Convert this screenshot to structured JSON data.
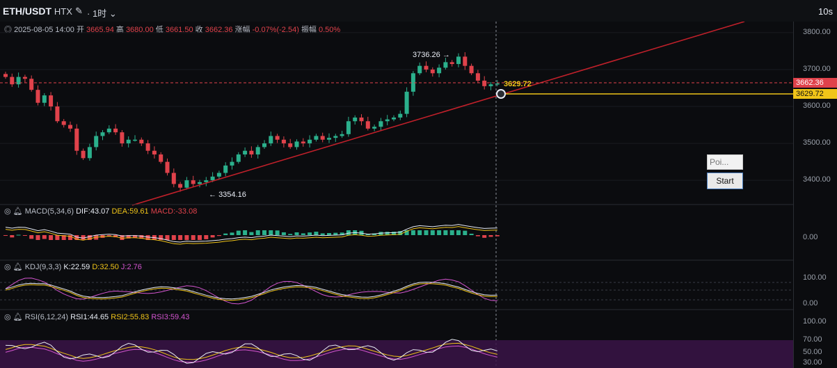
{
  "header": {
    "symbol": "ETH/USDT",
    "exchange": "HTX",
    "timeframe": "1时",
    "refresh": "10s",
    "icons": [
      "edit-icon",
      "chevron-down-icon"
    ]
  },
  "ohlc": {
    "datetime": "2025-08-05 14:00",
    "open_label": "开",
    "open": "3665.94",
    "high_label": "高",
    "high": "3680.00",
    "low_label": "低",
    "low": "3661.50",
    "close_label": "收",
    "close": "3662.36",
    "change_label": "涨幅",
    "change": "-0.07%(-2.54)",
    "amp_label": "振幅",
    "amp": "0.50%"
  },
  "price_axis": [
    "3800.00",
    "3700.00",
    "3600.00",
    "3500.00",
    "3400.00"
  ],
  "price_tags": {
    "last": "3662.36",
    "cursor": "3629.72"
  },
  "annotations": {
    "high": "3736.26",
    "low": "3354.16",
    "cursor": "3629.72"
  },
  "macd": {
    "name": "MACD(5,34,6)",
    "dif": "DIF:43.07",
    "dea": "DEA:59.61",
    "macd": "MACD:-33.08",
    "axis": [
      "0.00"
    ]
  },
  "kdj": {
    "name": "KDJ(9,3,3)",
    "k": "K:22.59",
    "d": "D:32.50",
    "j": "J:2.76",
    "axis": [
      "100.00",
      "0.00"
    ]
  },
  "rsi": {
    "name": "RSI(6,12,24)",
    "rsi1": "RSI1:44.65",
    "rsi2": "RSI2:55.83",
    "rsi3": "RSI3:59.43",
    "axis": [
      "100.00",
      "70.00",
      "50.00",
      "30.00"
    ]
  },
  "widget": {
    "input_placeholder": "Poi...",
    "start_label": "Start"
  },
  "colors": {
    "up": "#2bb08c",
    "down": "#e0424b",
    "trendline": "#c0202a",
    "cursor": "#f0c419",
    "rsi_band": "#3a1446"
  },
  "chart_data": {
    "type": "candlestick",
    "closes": [
      3680,
      3660,
      3680,
      3675,
      3645,
      3610,
      3630,
      3600,
      3560,
      3550,
      3540,
      3480,
      3460,
      3490,
      3520,
      3530,
      3540,
      3530,
      3500,
      3510,
      3510,
      3500,
      3480,
      3470,
      3450,
      3420,
      3390,
      3380,
      3400,
      3390,
      3395,
      3400,
      3410,
      3420,
      3440,
      3450,
      3470,
      3480,
      3470,
      3490,
      3500,
      3520,
      3510,
      3500,
      3490,
      3505,
      3500,
      3510,
      3520,
      3510,
      3515,
      3520,
      3525,
      3560,
      3570,
      3560,
      3540,
      3545,
      3560,
      3565,
      3570,
      3580,
      3640,
      3690,
      3710,
      3700,
      3690,
      3705,
      3720,
      3715,
      3735,
      3710,
      3690,
      3670,
      3655,
      3660,
      3662.36
    ],
    "ylim": [
      3340,
      3830
    ]
  }
}
